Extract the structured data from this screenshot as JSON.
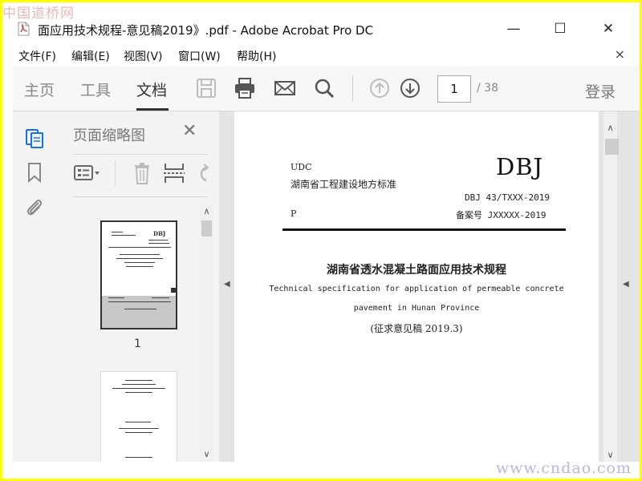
{
  "watermarks": {
    "top": "中国道桥网",
    "bottom": "www.cndao.com"
  },
  "window": {
    "title": "面应用技术规程-意见稿2019》.pdf - Adobe Acrobat Pro DC",
    "controls": {
      "minimize": "—",
      "maximize": "☐",
      "close": "✕"
    }
  },
  "menu": {
    "items": [
      "文件(F)",
      "编辑(E)",
      "视图(V)",
      "窗口(W)",
      "帮助(H)"
    ],
    "close_glyph": "×"
  },
  "toolbar": {
    "tabs": [
      {
        "label": "主页",
        "active": false
      },
      {
        "label": "工具",
        "active": false
      },
      {
        "label": "文档",
        "active": true
      }
    ],
    "icons": [
      "save-icon",
      "print-icon",
      "email-icon",
      "search-icon",
      "page-up-icon",
      "page-down-icon"
    ],
    "current_page": "1",
    "page_total": "/ 38",
    "login_label": "登录"
  },
  "rail": {
    "icons": [
      "page-thumbnails-icon",
      "bookmark-icon",
      "attachment-icon"
    ],
    "accent_color": "#1473e6"
  },
  "thumbnail_panel": {
    "title": "页面缩略图",
    "close_glyph": "✕",
    "thumbnails": [
      {
        "label": "1",
        "selected": true
      },
      {
        "label": "",
        "selected": false
      }
    ],
    "thumb1_text": {
      "dbj": "DBJ"
    }
  },
  "document": {
    "udc": "UDC",
    "standard_type": "湖南省工程建设地方标准",
    "dbj": "DBJ",
    "code": "DBJ 43/TXXX-2019",
    "p": "P",
    "record_no": "备案号 JXXXXX-2019",
    "title_cn": "湖南省透水混凝土路面应用技术规程",
    "title_en_line1": "Technical specification for application of permeable concrete",
    "title_en_line2": "pavement in Hunan Province",
    "draft": "(征求意见稿 2019.3)"
  }
}
